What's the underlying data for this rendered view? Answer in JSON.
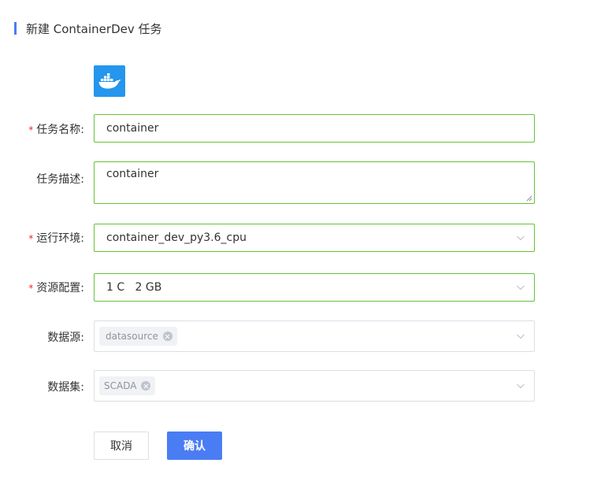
{
  "header": {
    "title": "新建 ContainerDev 任务"
  },
  "logo": {
    "icon": "docker-whale-icon",
    "color": "#2496ed"
  },
  "form": {
    "task_name": {
      "label": "任务名称:",
      "value": "container",
      "required": true
    },
    "task_desc": {
      "label": "任务描述:",
      "value": "container",
      "required": false
    },
    "runtime_env": {
      "label": "运行环境:",
      "value": "container_dev_py3.6_cpu",
      "required": true
    },
    "resource": {
      "label": "资源配置:",
      "value": "1 C   2 GB",
      "required": true
    },
    "datasource": {
      "label": "数据源:",
      "tag": "datasource"
    },
    "dataset": {
      "label": "数据集:",
      "tag": "SCADA"
    }
  },
  "actions": {
    "cancel_label": "取消",
    "confirm_label": "确认"
  },
  "colors": {
    "accent": "#4a7cf4",
    "valid_border": "#67c23a",
    "required_mark": "#f5222d"
  }
}
